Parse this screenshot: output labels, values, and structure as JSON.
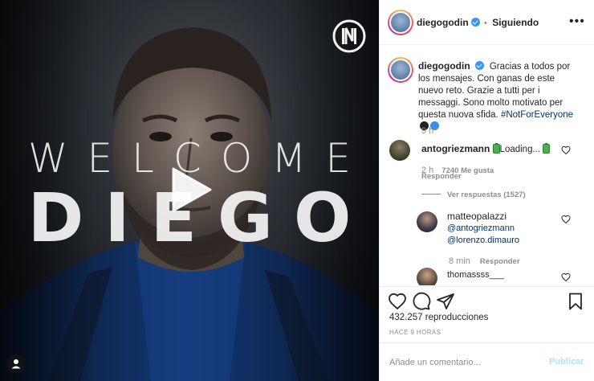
{
  "post": {
    "overlay_line1": "WELCOME",
    "overlay_line2": "DIEGO",
    "icons": {
      "play": "play-icon",
      "logo": "inter-logo",
      "tag": "person-tag-icon"
    }
  },
  "header": {
    "username": "diegogodin",
    "separator": "•",
    "follow_status": "Siguiendo",
    "more": "•••"
  },
  "caption": {
    "username": "diegogodin",
    "text": "Gracias a todos por los mensajes. Con ganas de este nuevo reto. Grazie a tutti per i messaggi. Sono molto motivato per questa nuova sfida.",
    "hashtag": "#NotForEveryone",
    "time": "9 h"
  },
  "comments": [
    {
      "username": "antogriezmann",
      "text": "Loading...",
      "time": "2 h",
      "likes": "7240 Me gusta",
      "reply": "Responder"
    },
    {
      "username": "matteopalazzi",
      "text_line1": "@antogriezmann",
      "text_line2": "@lorenzo.dimauro",
      "time": "8 min",
      "reply": "Responder"
    },
    {
      "username": "thomassss___"
    }
  ],
  "view_replies": "Ver respuestas (1527)",
  "stats": {
    "views": "432.257 reproducciones",
    "timestamp": "HACE 9 HORAS"
  },
  "comment_box": {
    "placeholder": "Añade un comentario...",
    "publish": "Publicar"
  },
  "colors": {
    "verified": "#3897f0",
    "hashtag": "#003569",
    "publish_disabled": "#b2dffc",
    "battery_green": "#4caf50"
  }
}
